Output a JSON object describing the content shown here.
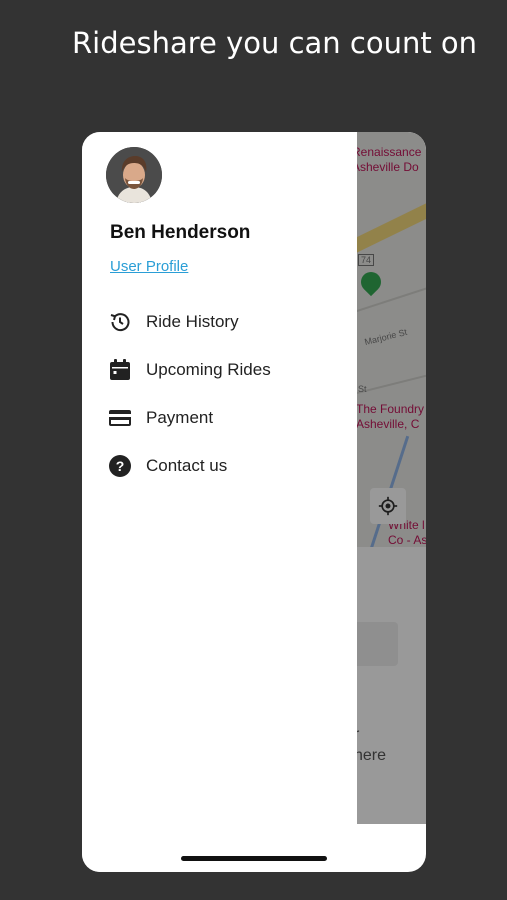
{
  "headline": "Rideshare you can count on",
  "user": {
    "name": "Ben Henderson",
    "profile_link": "User Profile"
  },
  "menu": [
    {
      "label": "Ride History",
      "icon": "history-icon"
    },
    {
      "label": "Upcoming Rides",
      "icon": "calendar-icon"
    },
    {
      "label": "Payment",
      "icon": "credit-card-icon"
    },
    {
      "label": "Contact us",
      "icon": "help-icon"
    }
  ],
  "map": {
    "poi_1_line1": "Renaissance",
    "poi_1_line2": "Asheville Do",
    "poi_2_line1": "The Foundry",
    "poi_2_line2": "Asheville, C",
    "poi_3_line1": "White l",
    "poi_3_line2": "Co - As",
    "street_1": "Marjorie St",
    "route_1": "74",
    "street_2": "St"
  },
  "panel": {
    "line1": "r",
    "line2": "here"
  },
  "colors": {
    "background": "#333333",
    "link": "#2a9ed6",
    "poi": "#c2185b"
  }
}
